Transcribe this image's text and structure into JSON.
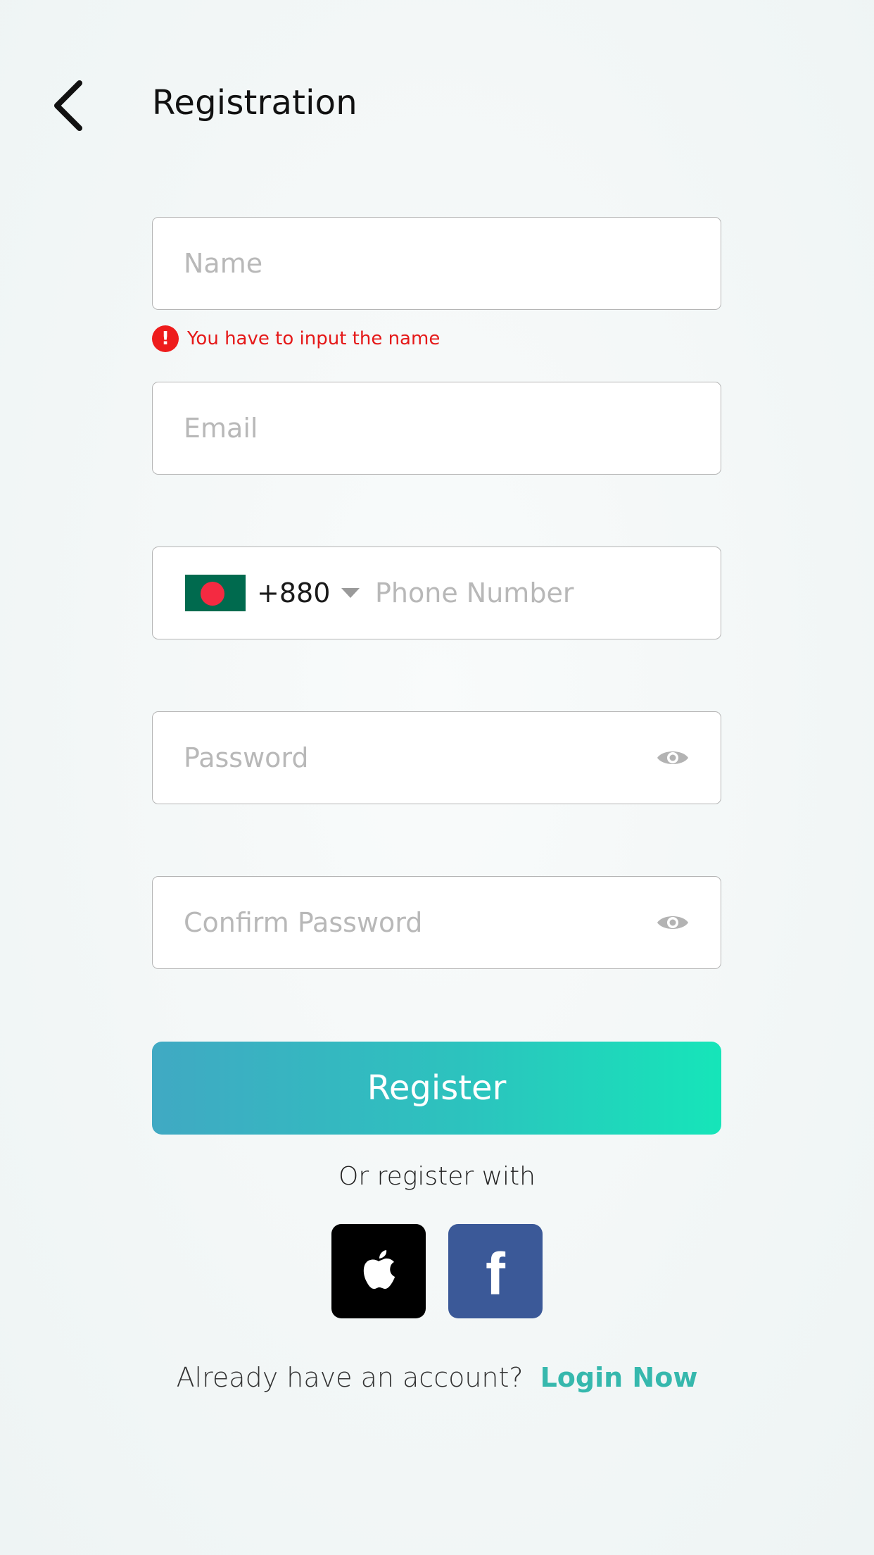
{
  "header": {
    "title": "Registration",
    "back_icon": "chevron-left-icon"
  },
  "form": {
    "name": {
      "placeholder": "Name",
      "value": ""
    },
    "name_error": "You have to input the name",
    "email": {
      "placeholder": "Email",
      "value": ""
    },
    "phone": {
      "country_flag": "bangladesh-flag-icon",
      "country_code": "+880",
      "placeholder": "Phone Number",
      "value": ""
    },
    "password": {
      "placeholder": "Password",
      "value": ""
    },
    "confirm_password": {
      "placeholder": "Confirm Password",
      "value": ""
    }
  },
  "register_button": "Register",
  "social": {
    "label": "Or register with",
    "providers": [
      "apple-icon",
      "facebook-icon"
    ]
  },
  "footer": {
    "question": "Already have an account?",
    "login_link": "Login Now"
  },
  "colors": {
    "accent": "#36b8ad",
    "error": "#e51919",
    "facebook": "#3b5998",
    "gradient_start": "#40a9c3",
    "gradient_end": "#16e5b9"
  }
}
